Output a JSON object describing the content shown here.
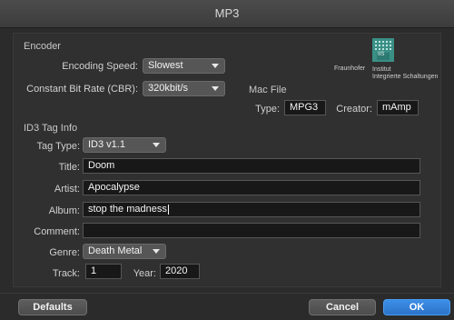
{
  "window": {
    "title": "MP3"
  },
  "encoder": {
    "section_label": "Encoder",
    "speed_label": "Encoding Speed:",
    "speed_value": "Slowest",
    "bitrate_label": "Constant Bit Rate (CBR):",
    "bitrate_value": "320kbit/s"
  },
  "logo": {
    "brand": "Fraunhofer",
    "line1": "Institut",
    "line2": "Integrierte Schaltungen",
    "badge": "IIS"
  },
  "mac_file": {
    "section_label": "Mac File",
    "type_label": "Type:",
    "type_value": "MPG3",
    "creator_label": "Creator:",
    "creator_value": "mAmp"
  },
  "id3": {
    "section_label": "ID3 Tag Info",
    "tag_type_label": "Tag Type:",
    "tag_type_value": "ID3 v1.1",
    "title_label": "Title:",
    "title_value": "Doom",
    "artist_label": "Artist:",
    "artist_value": "Apocalypse",
    "album_label": "Album:",
    "album_value": "stop the madness",
    "comment_label": "Comment:",
    "comment_value": "",
    "genre_label": "Genre:",
    "genre_value": "Death Metal",
    "track_label": "Track:",
    "track_value": "1",
    "year_label": "Year:",
    "year_value": "2020"
  },
  "buttons": {
    "defaults": "Defaults",
    "cancel": "Cancel",
    "ok": "OK"
  },
  "colors": {
    "ok_button": "#2b74c8",
    "field_bg": "#181818",
    "window_bg": "#2b2b2b"
  }
}
